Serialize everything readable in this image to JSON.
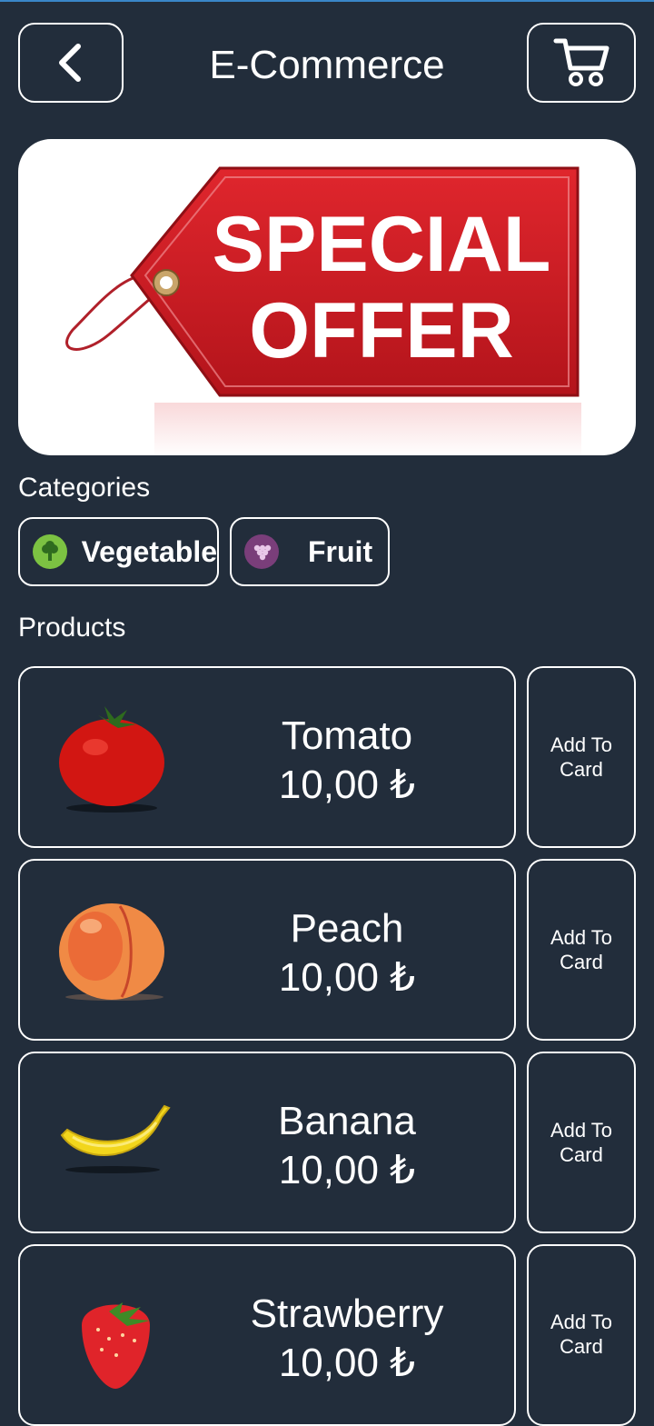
{
  "header": {
    "title": "E-Commerce",
    "back_icon": "chevron-left-icon",
    "cart_icon": "shopping-cart-icon"
  },
  "banner": {
    "line1": "SPECIAL",
    "line2": "OFFER",
    "tag_color": "#d61f26"
  },
  "categories": {
    "title": "Categories",
    "items": [
      {
        "label": "Vegetable",
        "icon": "broccoli-icon",
        "icon_color": "#7cc242"
      },
      {
        "label": "Fruit",
        "icon": "grapes-icon",
        "icon_color": "#7a3e7a"
      }
    ]
  },
  "products": {
    "title": "Products",
    "add_label": "Add To Card",
    "items": [
      {
        "name": "Tomato",
        "price": "10,00 ₺",
        "image": "tomato-image"
      },
      {
        "name": "Peach",
        "price": "10,00 ₺",
        "image": "peach-image"
      },
      {
        "name": "Banana",
        "price": "10,00 ₺",
        "image": "banana-image"
      },
      {
        "name": "Strawberry",
        "price": "10,00 ₺",
        "image": "strawberry-image"
      }
    ]
  },
  "colors": {
    "background": "#222d3b",
    "border": "#ffffff"
  }
}
